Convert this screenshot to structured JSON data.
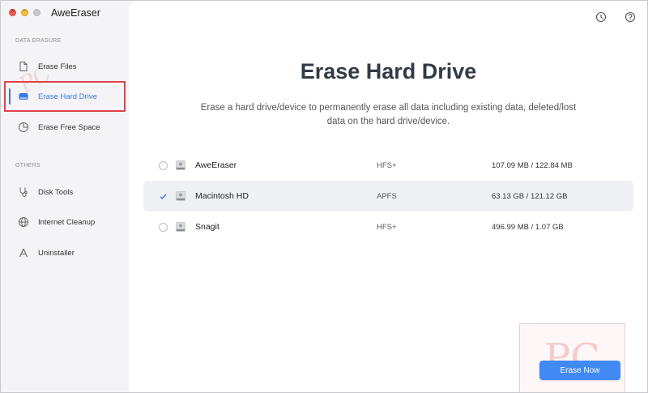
{
  "app": {
    "title": "AweEraser"
  },
  "sidebar": {
    "sections": [
      {
        "label": "DATA ERASURE"
      },
      {
        "label": "OTHERS"
      }
    ],
    "items": [
      {
        "label": "Erase Files",
        "icon": "file-icon"
      },
      {
        "label": "Erase Hard Drive",
        "icon": "hard-drive-icon",
        "active": true
      },
      {
        "label": "Erase Free Space",
        "icon": "pie-chart-icon"
      },
      {
        "label": "Disk Tools",
        "icon": "stethoscope-icon"
      },
      {
        "label": "Internet Cleanup",
        "icon": "globe-icon"
      },
      {
        "label": "Uninstaller",
        "icon": "app-store-icon"
      }
    ]
  },
  "header": {
    "icons": [
      "history-icon",
      "help-icon"
    ]
  },
  "main": {
    "title": "Erase Hard Drive",
    "description": "Erase a hard drive/device to permanently erase all data including existing data, deleted/lost data on the hard drive/device.",
    "drives": [
      {
        "name": "AweEraser",
        "filesystem": "HFS+",
        "size": "107.09 MB / 122.84 MB",
        "selected": false
      },
      {
        "name": "Macintosh HD",
        "filesystem": "APFS",
        "size": "63.13 GB / 121.12 GB",
        "selected": true
      },
      {
        "name": "Snagit",
        "filesystem": "HFS+",
        "size": "496.99 MB / 1.07 GB",
        "selected": false
      }
    ],
    "action_label": "Erase Now"
  },
  "watermark": {
    "text": "PC",
    "side_text": "PC"
  },
  "colors": {
    "accent": "#4189f4",
    "highlight": "#e0414a",
    "active_text": "#3a78e6"
  }
}
